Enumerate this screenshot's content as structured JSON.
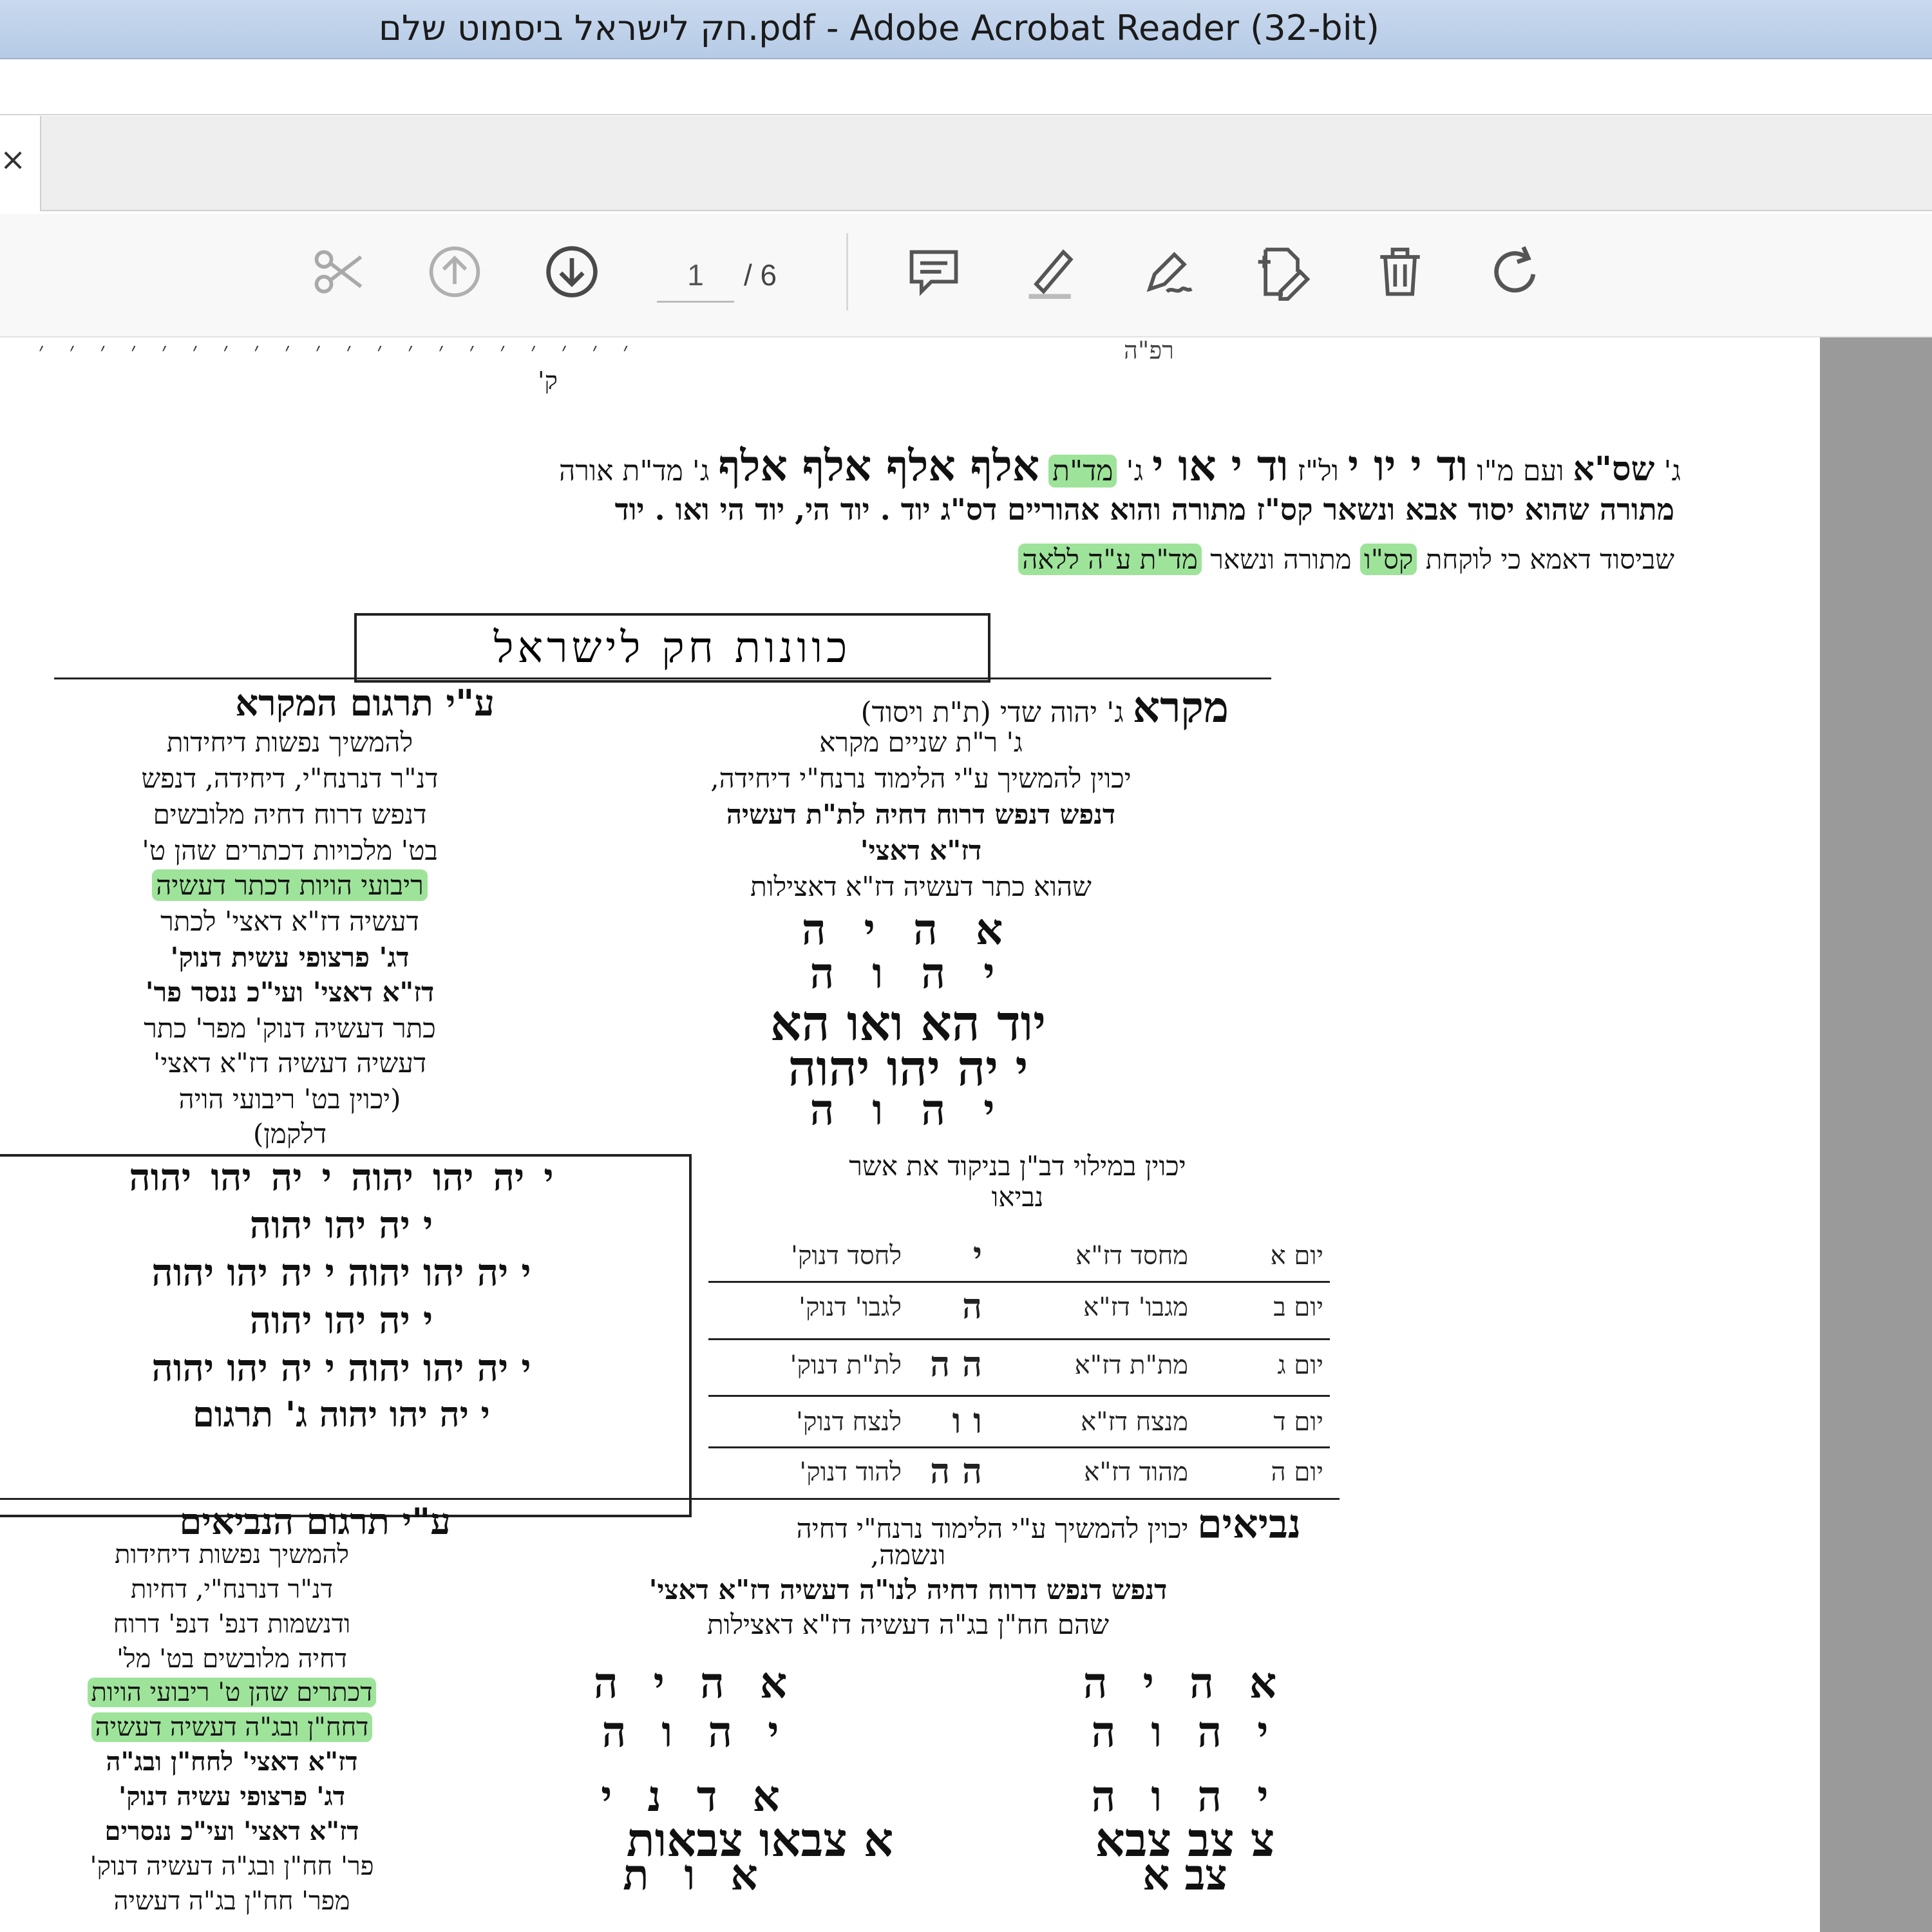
{
  "window": {
    "title": "חק לישראל ביסמוט שלם.pdf - Adobe Acrobat Reader (32-bit)"
  },
  "tab": {
    "close_label": "×"
  },
  "toolbar": {
    "page_current": "1",
    "page_total": "/ 6",
    "tools": [
      "scissors-icon",
      "page-up-icon",
      "page-down-icon",
      "comment-icon",
      "highlight-icon",
      "sign-icon",
      "edit-pdf-icon",
      "delete-icon",
      "rotate-icon"
    ]
  },
  "doc": {
    "top_fragment_left": "ק'",
    "top_fragment_right": "רפ\"ה",
    "line1": [
      "ג'",
      "שס\"א",
      "ועם מ\"ו",
      "וד י יו י",
      "ול\"ז",
      "וד י או י",
      "ג'",
      "מד\"ת",
      "אלף אלף אלף אלף",
      "ג' מד\"ת אורה"
    ],
    "line2": "מתורה שהוא יסוד אבא ונשאר קס\"ז מתורה והוא אהוריים דס\"ג יוד . יוד הי, יוד הי ואו . יוד",
    "line3": [
      "שביסוד דאמא כי לוקחת",
      "קס\"ו",
      "מתורה ונשאר",
      "מד\"ת ע\"ה ללאה"
    ],
    "title": "כוונות חק לישראל",
    "right_col": {
      "heading": "מקרא",
      "heading_rest": "ג' יהוה שדי (ת\"ת ויסוד)",
      "lines": [
        "ג' ר\"ת שניים מקרא",
        "יכוין להמשיך ע\"י הלימוד נרנח\"י דיחידה,",
        "דנפש דנפש דרוח דחיה לת\"ת דעשיה",
        "דז\"א דאצי'",
        "שהוא כתר דעשיה דז\"א דאצילות"
      ],
      "names": [
        "א ה י ה",
        "י ה ו ה",
        "יוד הא ואו הא",
        "י יה יהו יהוה",
        "י ה ו ה"
      ],
      "milui": [
        "יכוין במילוי דב\"ן בניקוד את אשר",
        "נביאו"
      ]
    },
    "left_col": {
      "heading": "ע\"י תרגום המקרא",
      "lines": [
        "להמשיך נפשות דיחידות",
        "דנ\"ר דנרנח\"י, דיחידה, דנפש",
        "דנפש דרוח דחיה מלובשים",
        "בט' מלכויות דכתרים שהן ט'",
        "ריבועי הויות דכתר דעשיה",
        "דעשיה דז\"א דאצי' לכתר",
        "דג' פרצופי עשית דנוק'",
        "דז\"א דאצי' ועי\"כ ננסר פר'",
        "כתר דעשיה דנוק' מפר' כתר",
        "דעשיה דעשיה דז\"א דאצי'",
        "(יכוין בט' ריבועי הויה",
        "דלקמן)"
      ]
    },
    "box_rows": [
      "י יה יהו יהוה     י יה יהו יהוה",
      "י יה יהו יהוה",
      "י יה יהו יהוה     י יה יהו יהוה",
      "י יה יהו יהוה",
      "י יה יהו יהוה     י יה יהו יהוה",
      "י יה יהו יהוה ג' תרגום"
    ],
    "days": [
      {
        "day": "יום א",
        "from": "מחסד דז\"א",
        "letter": "י",
        "to": "לחסד דנוק'"
      },
      {
        "day": "יום ב",
        "from": "מגבו' דז\"א",
        "letter": "ה",
        "to": "לגבו' דנוק'"
      },
      {
        "day": "יום ג",
        "from": "מת\"ת דז\"א",
        "letter": "ה ה",
        "to": "לת\"ת דנוק'"
      },
      {
        "day": "יום ד",
        "from": "מנצח דז\"א",
        "letter": "ו ו",
        "to": "לנצח דנוק'"
      },
      {
        "day": "יום ה",
        "from": "מהוד דז\"א",
        "letter": "ה ה",
        "to": "להוד דנוק'"
      }
    ],
    "neviim": {
      "heading": "נביאים",
      "lines": [
        "יכוין להמשיך ע\"י הלימוד נרנח\"י דחיה",
        "ונשמה,",
        "דנפש דנפש דרוח דחיה לנו\"ה דעשיה דז\"א דאצי'",
        "שהם חח\"ן בג\"ה דעשיה דז\"א דאצילות"
      ],
      "names_right": [
        "א ה י ה",
        "י ה ו ה",
        "י ה ו ה",
        "צ צב צבא",
        "צב א"
      ],
      "names_left": [
        "א ה י ה",
        "י ה ו ה",
        "א ד נ י",
        "א צבאו צבאות",
        "א ו ת"
      ]
    },
    "targum_neviim": {
      "heading": "ע\"י תרגום הנביאים",
      "lines": [
        "להמשיך נפשות דיחידות",
        "דנ\"ר דנרנח\"י, דחיות",
        "ודנשמות דנפ' דנפ' דרוח",
        "דחיה מלובשים בט' מל'",
        "דכתרים שהן ט' ריבועי הויות",
        "דחח\"ן ובג\"ה דעשיה דעשיה",
        "דז\"א דאצי' לחח\"ן ובג\"ה",
        "דג' פרצופי עשיה דנוק'",
        "דז\"א דאצי' ועי\"כ ננסרים",
        "פר' חח\"ן ובג\"ה דעשיה דנוק'",
        "מפר' חח\"ן בג\"ה דעשיה"
      ]
    }
  }
}
